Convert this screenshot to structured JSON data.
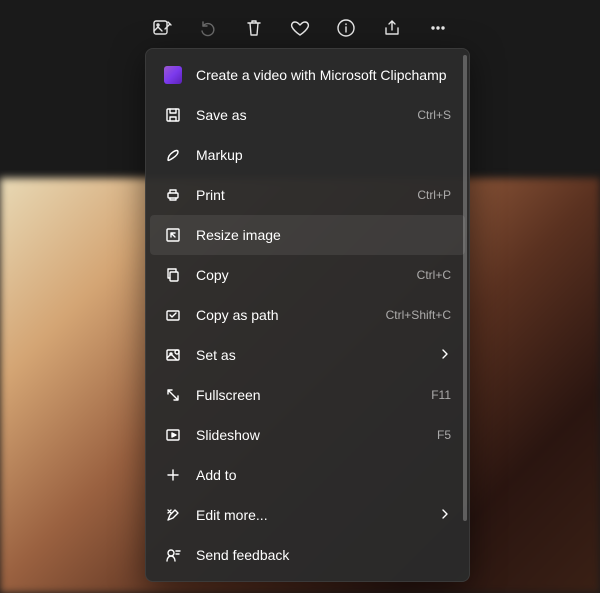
{
  "toolbar": {
    "items": [
      {
        "name": "image-edit-icon"
      },
      {
        "name": "undo-icon"
      },
      {
        "name": "delete-icon"
      },
      {
        "name": "favorite-icon"
      },
      {
        "name": "info-icon"
      },
      {
        "name": "share-icon"
      },
      {
        "name": "more-icon"
      }
    ]
  },
  "menu": {
    "items": [
      {
        "name": "clipchamp",
        "label": "Create a video with Microsoft Clipchamp",
        "accel": "",
        "icon": "clipchamp"
      },
      {
        "name": "save-as",
        "label": "Save as",
        "accel": "Ctrl+S",
        "icon": "save"
      },
      {
        "name": "markup",
        "label": "Markup",
        "accel": "",
        "icon": "markup"
      },
      {
        "name": "print",
        "label": "Print",
        "accel": "Ctrl+P",
        "icon": "print"
      },
      {
        "name": "resize-image",
        "label": "Resize image",
        "accel": "",
        "icon": "resize",
        "highlight": true
      },
      {
        "name": "copy",
        "label": "Copy",
        "accel": "Ctrl+C",
        "icon": "copy"
      },
      {
        "name": "copy-as-path",
        "label": "Copy as path",
        "accel": "Ctrl+Shift+C",
        "icon": "copypath"
      },
      {
        "name": "set-as",
        "label": "Set as",
        "accel": "",
        "icon": "setas",
        "chevron": true
      },
      {
        "name": "fullscreen",
        "label": "Fullscreen",
        "accel": "F11",
        "icon": "fullscreen"
      },
      {
        "name": "slideshow",
        "label": "Slideshow",
        "accel": "F5",
        "icon": "slideshow"
      },
      {
        "name": "add-to",
        "label": "Add to",
        "accel": "",
        "icon": "add"
      },
      {
        "name": "edit-more",
        "label": "Edit more...",
        "accel": "",
        "icon": "editmore",
        "chevron": true
      },
      {
        "name": "send-feedback",
        "label": "Send feedback",
        "accel": "",
        "icon": "feedback"
      }
    ]
  }
}
